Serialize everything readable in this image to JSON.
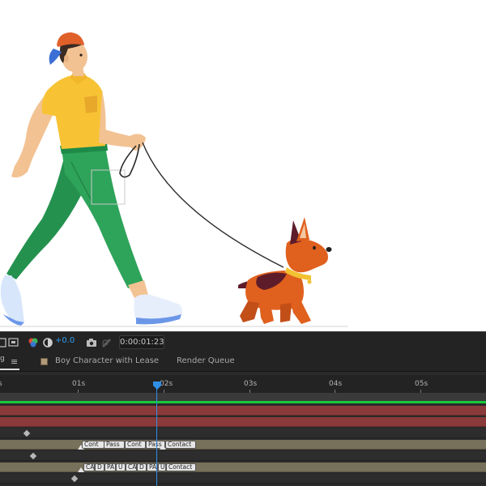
{
  "viewer_toolbar": {
    "zoom_value": "+0.0",
    "timecode": "0:00:01:23",
    "icons": [
      "region-of-interest-icon",
      "transparency-grid-icon",
      "color-channels-icon",
      "reset-exposure-icon",
      "snapshot-icon",
      "show-snapshot-icon"
    ]
  },
  "tabs": {
    "composition_tab_fragment": "g",
    "composition_label": "Boy Character with Lease",
    "render_queue_label": "Render Queue"
  },
  "timeline": {
    "ruler_labels": [
      "s",
      "01s",
      "02s",
      "03s",
      "04s",
      "05s"
    ],
    "marker_row_1": [
      "Cont",
      "Pass",
      "Cont",
      "Pass",
      "Contact"
    ],
    "marker_row_2": [
      "CA",
      "D",
      "PA",
      "U",
      "CA",
      "D",
      "PA",
      "U",
      "Contact"
    ]
  },
  "colors": {
    "work_area_bar": "#19c93a",
    "playhead": "#2f8fe6",
    "shirt": "#f7c335",
    "pants": "#2ea35a",
    "cap": "#e0602a",
    "dog": "#e0601e"
  }
}
